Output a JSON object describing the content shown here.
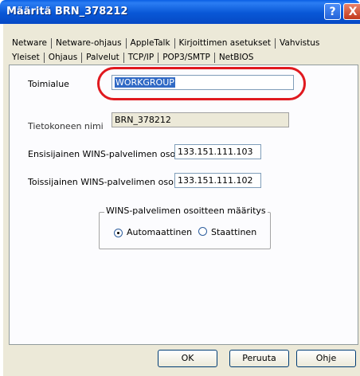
{
  "window": {
    "title": "Määritä BRN_378212"
  },
  "titlebar_buttons": {
    "help": "?",
    "close": "X"
  },
  "tabs": {
    "row1": [
      "Netware",
      "Netware-ohjaus",
      "AppleTalk",
      "Kirjoittimen asetukset",
      "Vahvistus"
    ],
    "row2": [
      "Yleiset",
      "Ohjaus",
      "Palvelut",
      "TCP/IP",
      "POP3/SMTP",
      "NetBIOS"
    ],
    "active": "NetBIOS"
  },
  "form": {
    "workgroup_label": "Toimialue",
    "workgroup_value": "WORKGROUP",
    "computer_name_label": "Tietokoneen nimi",
    "computer_name_value": "BRN_378212",
    "primary_wins_label": "Ensisijainen WINS-palvelimen osoite",
    "primary_wins_value": "133.151.111.103",
    "secondary_wins_label": "Toissijainen WINS-palvelimen osoite",
    "secondary_wins_value": "133.151.111.102"
  },
  "wins_group": {
    "label": "WINS-palvelimen osoitteen määritys",
    "option_auto": "Automaattinen",
    "option_static": "Staattinen",
    "selected": "Automaattinen"
  },
  "buttons": {
    "ok": "OK",
    "cancel": "Peruuta",
    "help": "Ohje"
  },
  "colors": {
    "highlight_oval": "#e0191f",
    "titlebar": "#0857d6",
    "selection": "#316ac5"
  }
}
